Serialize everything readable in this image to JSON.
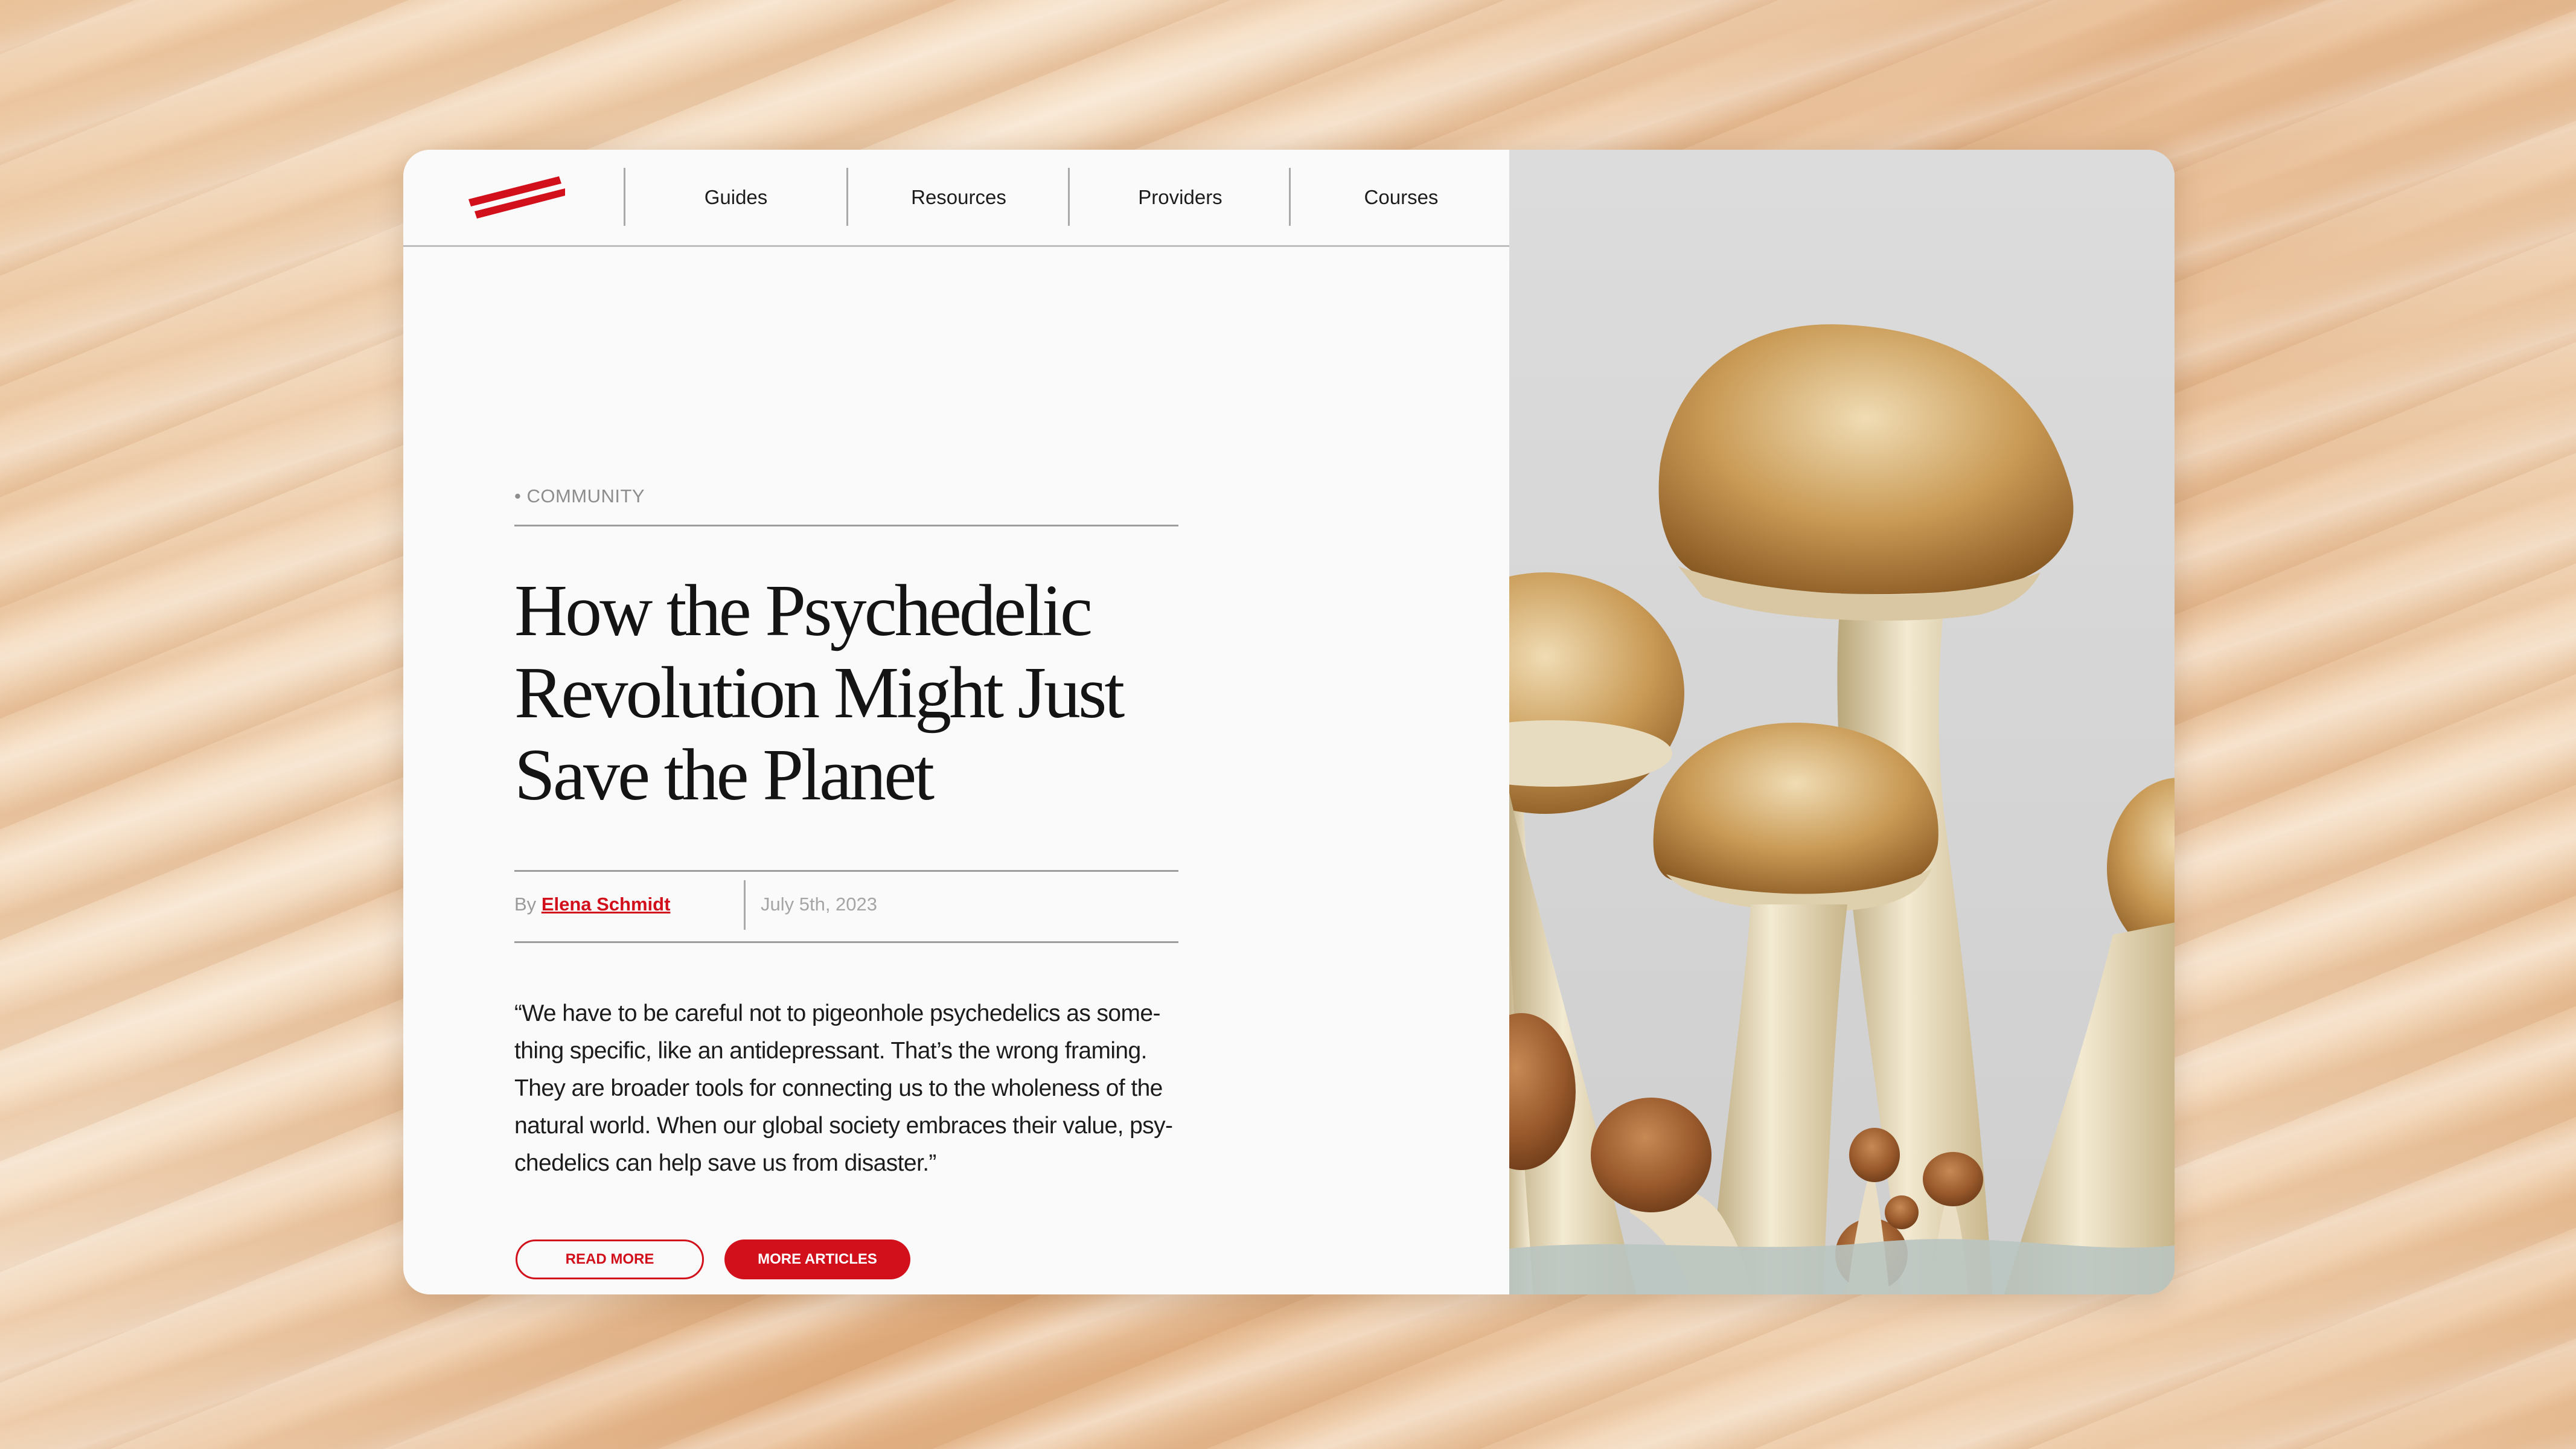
{
  "nav": {
    "logo": "brand-logo",
    "items": [
      {
        "label": "Guides"
      },
      {
        "label": "Resources"
      },
      {
        "label": "Providers"
      },
      {
        "label": "Courses"
      }
    ]
  },
  "article": {
    "category": "• COMMUNITY",
    "title_lines": [
      "How the Psychedelic",
      "Revolution Might Just",
      "Save the Planet"
    ],
    "by_prefix": "By",
    "author": "Elena Schmidt",
    "date": "July 5th, 2023",
    "quote_lines": [
      "“We have to be careful not to pigeonhole psychedelics as some-",
      "thing specific, like an antidepressant. That’s the wrong framing.",
      "They are broader tools for connecting us to the wholeness of the",
      "natural world. When our global society embraces their value, psy-",
      "chedelics can help save us from disaster.”"
    ]
  },
  "buttons": {
    "read_more": "READ MORE",
    "more_articles": "MORE ARTICLES"
  },
  "colors": {
    "accent": "#d1101b",
    "card_bg": "#fafafa",
    "photo_bg": "#d9d9d9"
  }
}
